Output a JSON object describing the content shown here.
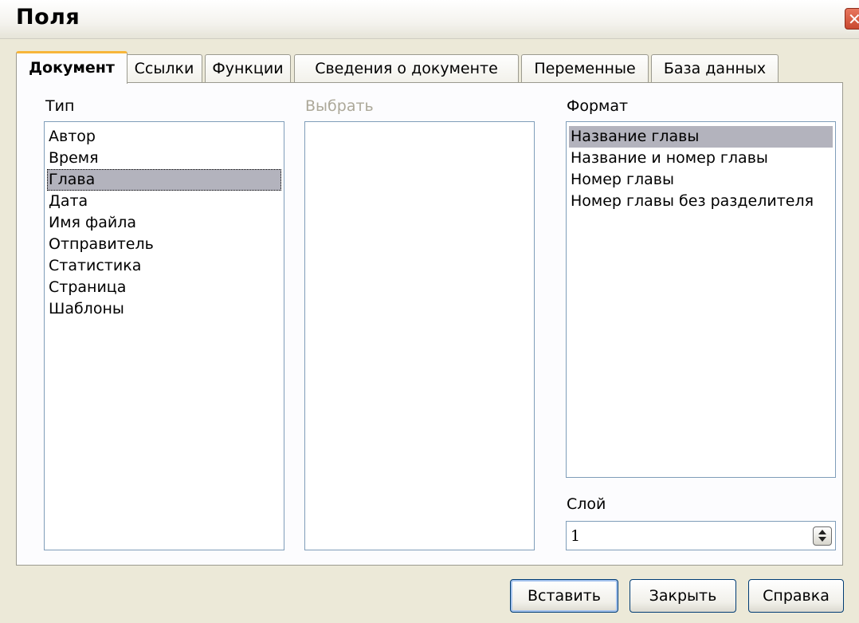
{
  "window": {
    "title": "Поля",
    "close_icon": "close-icon"
  },
  "tabs": [
    {
      "label": "Документ",
      "active": true
    },
    {
      "label": "Ссылки",
      "active": false
    },
    {
      "label": "Функции",
      "active": false
    },
    {
      "label": "Сведения о документе",
      "active": false
    },
    {
      "label": "Переменные",
      "active": false
    },
    {
      "label": "База данных",
      "active": false
    }
  ],
  "type_list": {
    "label": "Тип",
    "items": [
      "Автор",
      "Время",
      "Глава",
      "Дата",
      "Имя файла",
      "Отправитель",
      "Статистика",
      "Страница",
      "Шаблоны"
    ],
    "selected": "Глава"
  },
  "select_list": {
    "label": "Выбрать",
    "items": []
  },
  "format_list": {
    "label": "Формат",
    "items": [
      "Название главы",
      "Название и номер главы",
      "Номер главы",
      "Номер главы без разделителя"
    ],
    "selected": "Название главы"
  },
  "level": {
    "label": "Слой",
    "value": "1",
    "stepper_icon": "spin-arrows-icon"
  },
  "buttons": {
    "insert": "Вставить",
    "close": "Закрыть",
    "help": "Справка"
  },
  "colors": {
    "dialog_bg": "#ece9d8",
    "active_tab_accent": "#f7b63a",
    "selection": "#b3b3bd",
    "close_button": "#c9482f"
  }
}
